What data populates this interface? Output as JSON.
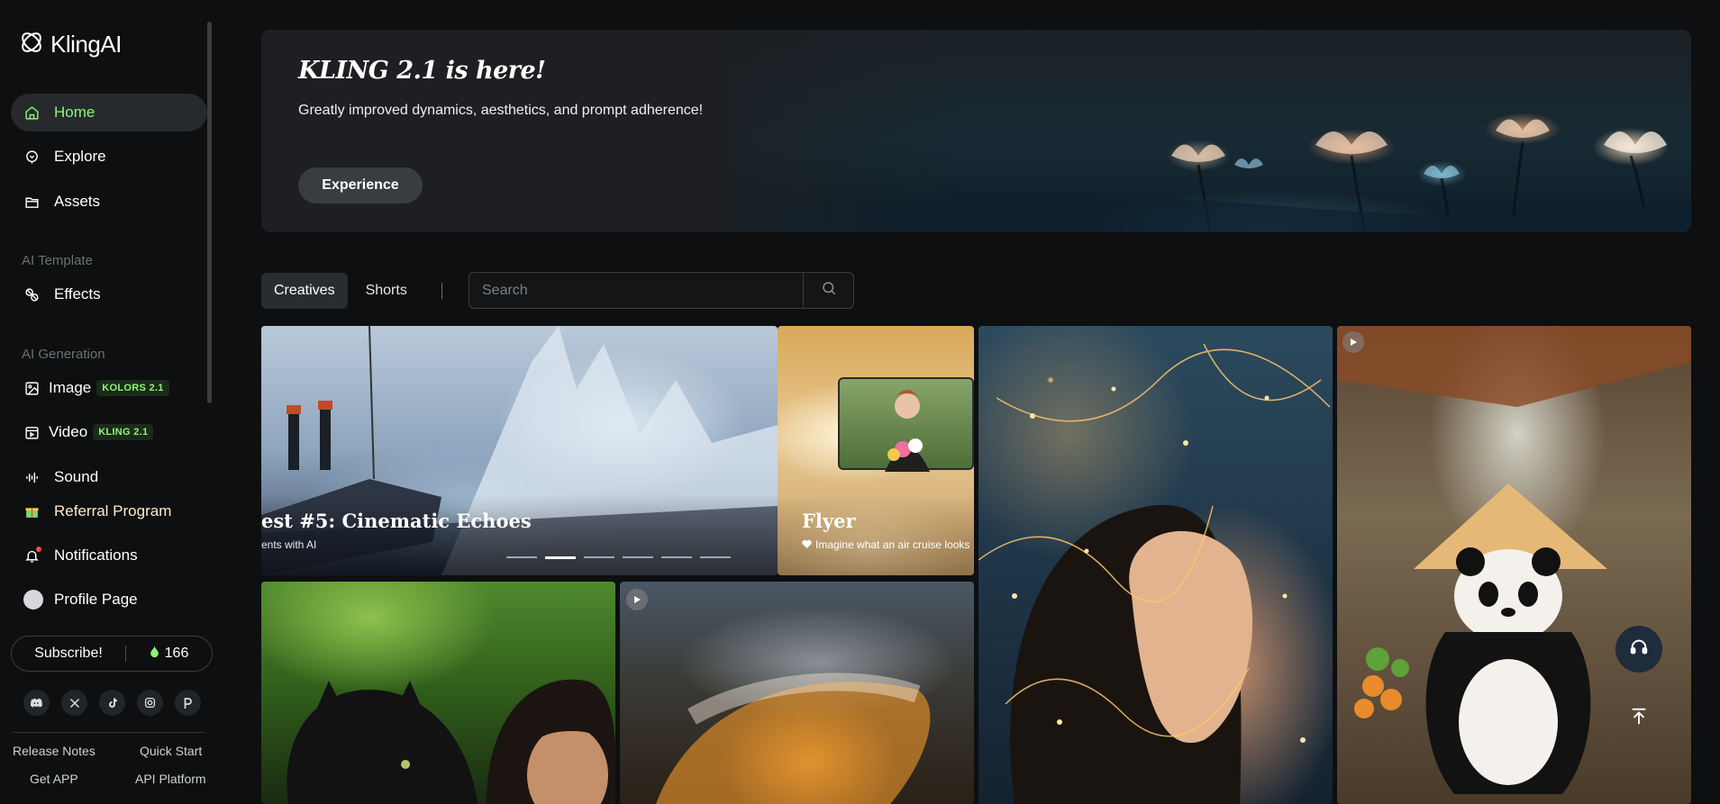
{
  "app": {
    "name": "KlingAI"
  },
  "sidebar": {
    "nav": [
      {
        "label": "Home",
        "icon": "home-icon",
        "active": true
      },
      {
        "label": "Explore",
        "icon": "explore-icon"
      },
      {
        "label": "Assets",
        "icon": "folder-icon"
      }
    ],
    "section_template": "AI Template",
    "effects_label": "Effects",
    "section_generation": "AI Generation",
    "image_label": "Image",
    "image_badge": "KOLORS 2.1",
    "video_label": "Video",
    "video_badge": "KLING 2.1",
    "sound_label": "Sound",
    "referral_label": "Referral Program",
    "notifications_label": "Notifications",
    "profile_label": "Profile Page",
    "subscribe_label": "Subscribe!",
    "credits": "166",
    "socials": [
      "discord-icon",
      "x-icon",
      "tiktok-icon",
      "instagram-icon",
      "p-icon"
    ],
    "footer": {
      "release_notes": "Release Notes",
      "quick_start": "Quick Start",
      "get_app": "Get APP",
      "api_platform": "API Platform"
    }
  },
  "banner": {
    "title": "KLING 2.1 is here!",
    "subtitle": "Greatly improved dynamics, aesthetics, and prompt adherence!",
    "button": "Experience"
  },
  "tabs": [
    "Creatives",
    "Shorts"
  ],
  "search": {
    "placeholder": "Search"
  },
  "cards": {
    "carousel": {
      "title": "est #5: Cinematic Echoes",
      "subtitle": "ents with AI",
      "slide_count": 6,
      "active_slide": 2
    },
    "flyer": {
      "title": "Flyer",
      "subtitle": "Imagine what an air cruise looks"
    }
  },
  "colors": {
    "accent": "#8cf576",
    "background": "#0d0f10",
    "notification": "#ff4848"
  }
}
